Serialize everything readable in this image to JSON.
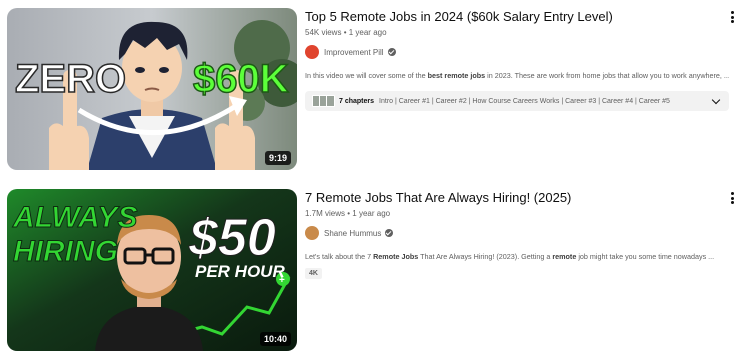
{
  "results": [
    {
      "title": "Top 5 Remote Jobs in 2024 ($60k Salary Entry Level)",
      "views": "54K views",
      "age": "1 year ago",
      "channel": "Improvement Pill",
      "duration": "9:19",
      "thumb_text": {
        "left": "ZERO",
        "right": "$60K"
      },
      "description_parts": [
        "In this video we will cover some of the ",
        "best remote jobs",
        " in 2023. These are work from home jobs that allow you to work anywhere, ..."
      ],
      "chapters": {
        "count": "7 chapters",
        "list": "Intro | Career #1 | Career #2 | How Course Careers Works | Career #3 | Career #4 | Career #5"
      },
      "colors": {
        "accent_green": "#5cff3a",
        "avatar": "#e0442e"
      }
    },
    {
      "title": "7 Remote Jobs That Are Always Hiring! (2025)",
      "views": "1.7M views",
      "age": "1 year ago",
      "channel": "Shane Hummus",
      "duration": "10:40",
      "thumb_text": {
        "line1": "ALWAYS",
        "line2": "HIRING",
        "amount": "$50",
        "per": "PER HOUR"
      },
      "description_parts": [
        "Let's talk about the 7 ",
        "Remote Jobs",
        " That Are Always Hiring! (2023). Getting a ",
        "remote",
        " job might take you some time nowadays ..."
      ],
      "badge": "4K",
      "colors": {
        "accent_green": "#33d633",
        "avatar": "#c98a4a"
      }
    }
  ],
  "icons": {
    "more": "more-vert-icon",
    "verified": "verified-check-icon",
    "expand": "chevron-down-icon"
  }
}
